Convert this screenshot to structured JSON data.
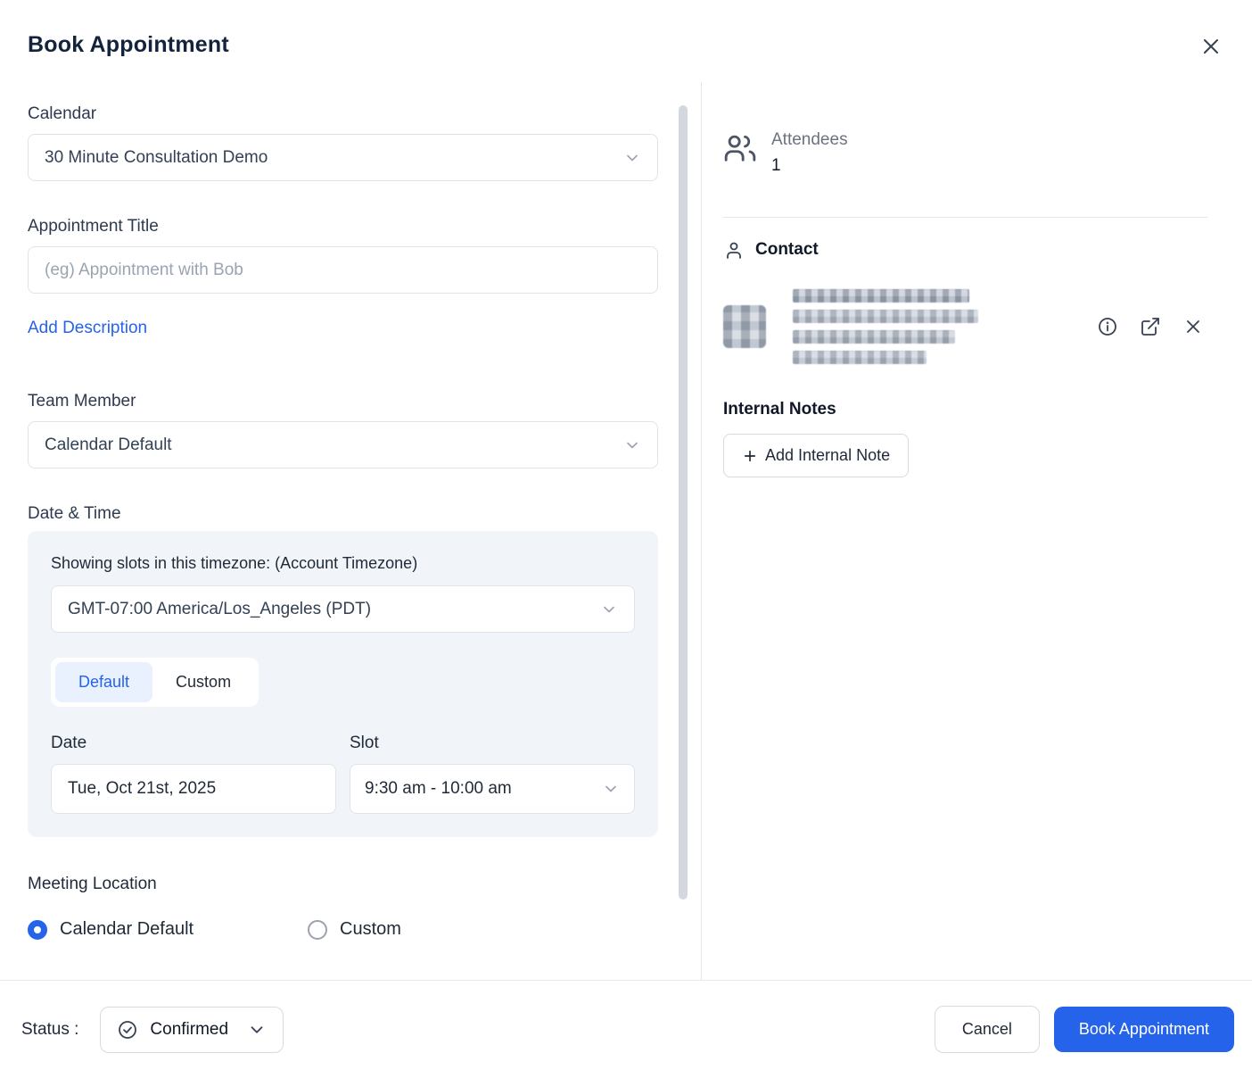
{
  "modal": {
    "title": "Book Appointment"
  },
  "form": {
    "calendar": {
      "label": "Calendar",
      "value": "30 Minute Consultation Demo"
    },
    "appointment_title": {
      "label": "Appointment Title",
      "placeholder": "(eg) Appointment with Bob"
    },
    "add_description": "Add Description",
    "team_member": {
      "label": "Team Member",
      "value": "Calendar Default"
    },
    "date_time": {
      "label": "Date & Time",
      "timezone_note": "Showing slots in this timezone: (Account Timezone)",
      "timezone": "GMT-07:00 America/Los_Angeles (PDT)",
      "tabs": [
        {
          "label": "Default",
          "active": true
        },
        {
          "label": "Custom",
          "active": false
        }
      ],
      "date": {
        "label": "Date",
        "value": "Tue, Oct 21st, 2025"
      },
      "slot": {
        "label": "Slot",
        "value": "9:30 am - 10:00 am"
      }
    },
    "meeting_location": {
      "label": "Meeting Location",
      "options": [
        {
          "label": "Calendar Default",
          "selected": true
        },
        {
          "label": "Custom",
          "selected": false
        }
      ]
    }
  },
  "sidebar": {
    "attendees": {
      "label": "Attendees",
      "count": "1"
    },
    "contact": {
      "label": "Contact"
    },
    "internal_notes": {
      "label": "Internal Notes",
      "add_note_label": "Add Internal Note"
    }
  },
  "footer": {
    "status_label": "Status :",
    "status_value": "Confirmed",
    "cancel_label": "Cancel",
    "book_label": "Book Appointment"
  },
  "colors": {
    "primary": "#2563eb",
    "tab_active_bg": "#eaf1fe",
    "panel_bg": "#f1f5f9"
  }
}
